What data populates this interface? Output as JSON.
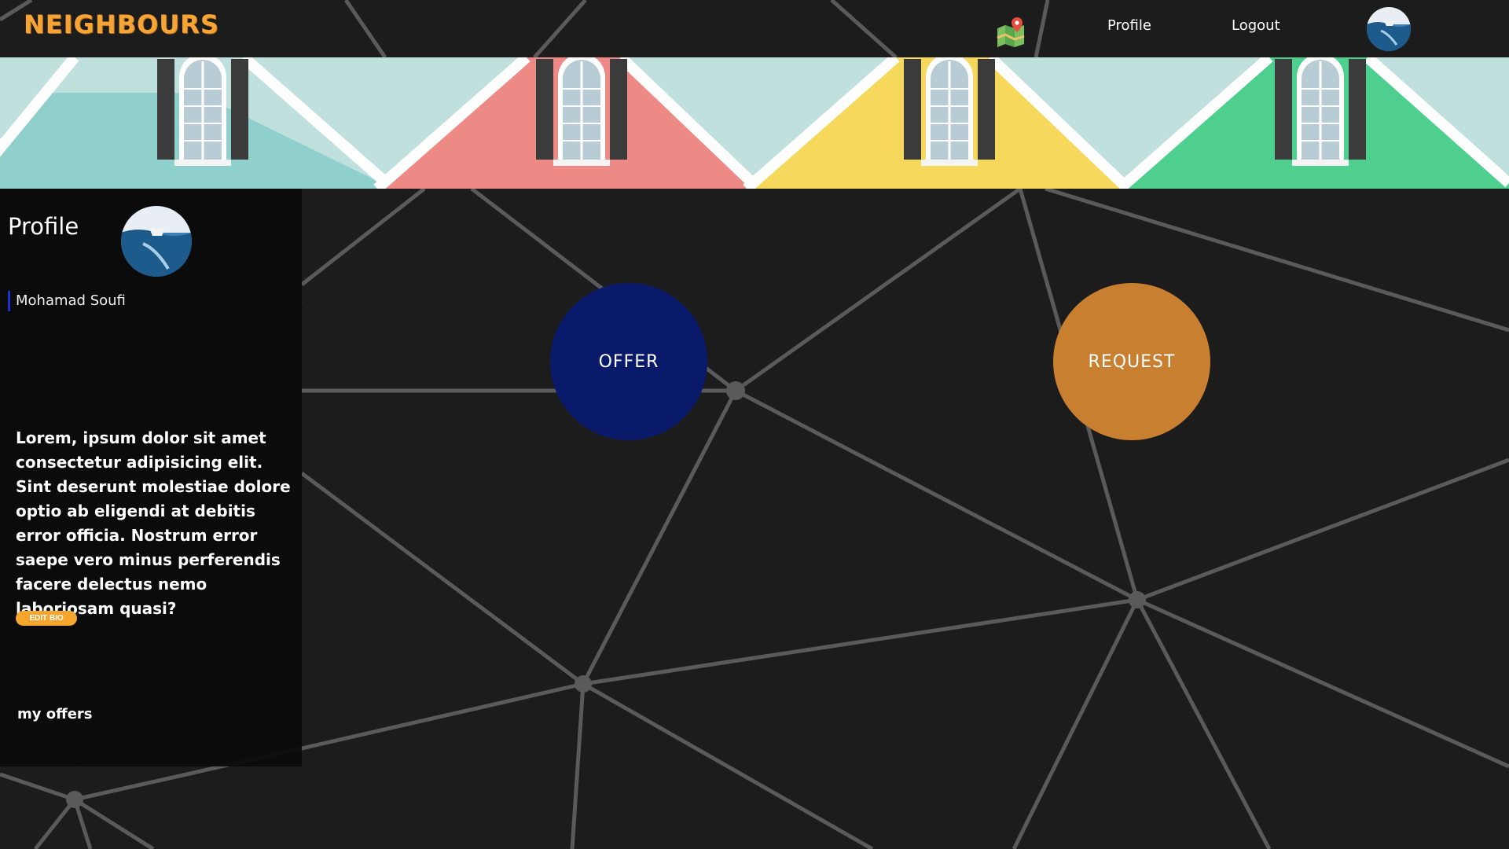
{
  "header": {
    "logo": "NEIGHBOURS",
    "nav": {
      "profile_label": "Profile",
      "logout_label": "Logout"
    },
    "icons": [
      "map-icon",
      "avatar"
    ]
  },
  "banner": {
    "house_colors": [
      "#8fd0cd",
      "#ee8a86",
      "#f5d85c",
      "#4fcf8e"
    ],
    "sky_color": "#bfe0dc"
  },
  "sidebar": {
    "title": "Profile",
    "user_name": "Mohamad Soufi",
    "bio": "Lorem, ipsum dolor sit amet consectetur adipisicing elit. Sint deserunt molestiae dolore optio ab eligendi at debitis error officia. Nostrum error saepe vero minus perferendis facere delectus nemo laboriosam quasi?",
    "edit_bio_label": "EDIT BIO",
    "my_offers_label": "my offers"
  },
  "main": {
    "offer_label": "OFFER",
    "request_label": "REQUEST"
  },
  "colors": {
    "background": "#1c1c1c",
    "accent": "#f6a435",
    "offer": "#0a1a6b",
    "request": "#c88030",
    "network_lines": "#5a5a5a"
  }
}
